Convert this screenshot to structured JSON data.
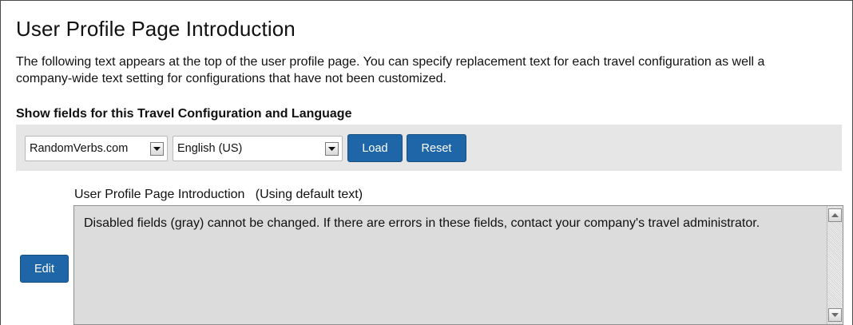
{
  "page": {
    "title": "User Profile Page Introduction",
    "intro_text": "The following text appears at the top of the user profile page. You can specify replacement text for each travel configuration as well a company-wide text setting for configurations that have not been customized."
  },
  "config": {
    "section_label": "Show fields for this Travel Configuration and Language",
    "travel_config_value": "RandomVerbs.com",
    "language_value": "English (US)",
    "load_label": "Load",
    "reset_label": "Reset"
  },
  "field": {
    "label": "User Profile Page Introduction   (Using default text)",
    "text": "Disabled fields (gray) cannot be changed. If there are errors in these fields, contact your company's travel administrator.",
    "edit_label": "Edit"
  },
  "icons": {
    "dropdown": "chevron-down-icon",
    "scroll_up": "arrow-up-icon",
    "scroll_down": "arrow-down-icon"
  },
  "colors": {
    "button_blue": "#1f66a8",
    "bar_gray": "#e6e6e6",
    "disabled_field_gray": "#dcdcdc"
  }
}
